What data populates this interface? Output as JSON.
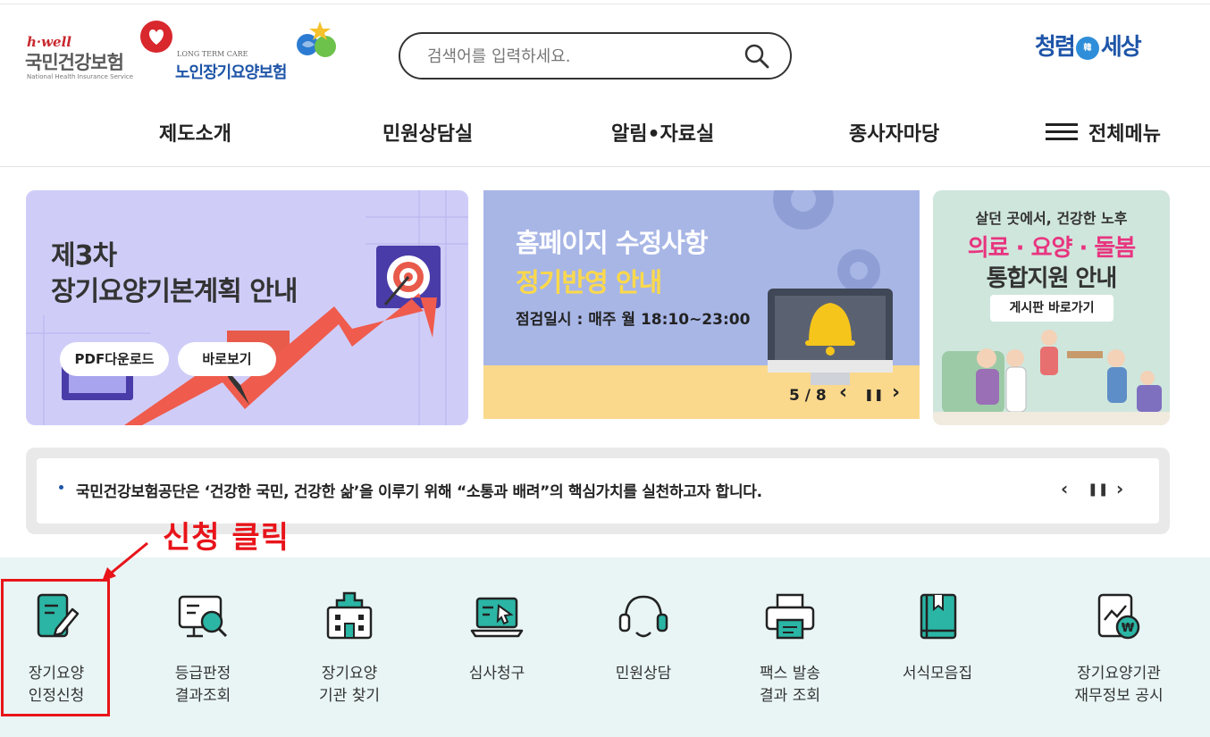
{
  "header": {
    "logo_nhis": {
      "tagline": "h·well",
      "name": "국민건강보험",
      "english": "National Health Insurance Service"
    },
    "logo_ltc": {
      "tagline": "LONG TERM CARE",
      "name": "노인장기요양보험"
    },
    "search": {
      "placeholder": "검색어를 입력하세요.",
      "icon": "search-icon"
    },
    "logo_clean": {
      "left": "청렴",
      "mid": "韓",
      "right": "세상"
    }
  },
  "nav": {
    "items": [
      "제도소개",
      "민원상담실",
      "알림•자료실",
      "종사자마당"
    ],
    "all_menu": "전체메뉴"
  },
  "banners": {
    "b1": {
      "line1": "제3차",
      "line2": "장기요양기본계획 안내",
      "btn_pdf": "PDF다운로드",
      "btn_view": "바로보기"
    },
    "b2": {
      "line1": "홈페이지 수정사항",
      "line2": "정기반영 안내",
      "line3": "점검일시 : 매주 월 18:10~23:00",
      "pager": "5 / 8",
      "prev": "‹",
      "pause": "❚❚",
      "next": "›"
    },
    "b3": {
      "line1": "살던 곳에서, 건강한 노후",
      "line2": "의료 · 요양 · 돌봄",
      "line3": "통합지원 안내",
      "btn": "게시판 바로가기"
    }
  },
  "notice": {
    "text": "국민건강보험공단은 ‘건강한 국민, 건강한 삶’을 이루기 위해 “소통과 배려”의 핵심가치를 실천하고자 합니다.",
    "prev": "‹",
    "pause": "❚❚",
    "next": "›"
  },
  "annotation": {
    "text": "신청 클릭",
    "color": "#e8141a"
  },
  "quick_menu": [
    {
      "label": "장기요양\n인정신청",
      "icon": "application-pen-icon"
    },
    {
      "label": "등급판정\n결과조회",
      "icon": "monitor-search-icon"
    },
    {
      "label": "장기요양\n기관 찾기",
      "icon": "hospital-icon"
    },
    {
      "label": "심사청구",
      "icon": "laptop-cursor-icon"
    },
    {
      "label": "민원상담",
      "icon": "headset-icon"
    },
    {
      "label": "팩스 발송\n결과 조회",
      "icon": "printer-icon"
    },
    {
      "label": "서식모음집",
      "icon": "book-icon"
    },
    {
      "label": "장기요양기관\n재무정보 공시",
      "icon": "finance-document-icon"
    }
  ],
  "colors": {
    "accent_teal": "#2bb5a5",
    "brand_blue": "#1e55a8",
    "quick_bg": "#e9f5f5"
  }
}
